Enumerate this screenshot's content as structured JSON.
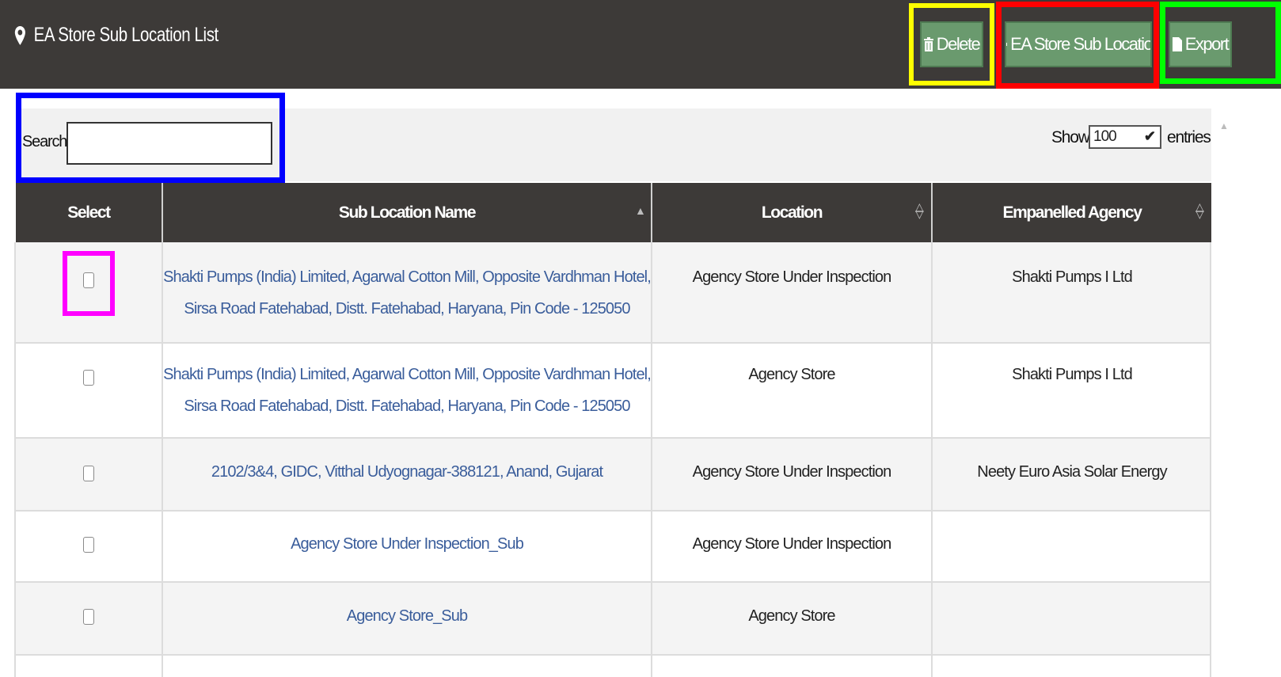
{
  "header": {
    "title": "EA Store Sub Location List",
    "buttons": {
      "delete": "Delete",
      "add": "EA Store Sub Location",
      "export": "Export"
    }
  },
  "toolbar": {
    "search_label": "Search:",
    "search_value": "",
    "show_label": "Show",
    "entries_value": "100",
    "entries_label": "entries"
  },
  "table": {
    "columns": [
      "Select",
      "Sub Location Name",
      "Location",
      "Empanelled Agency"
    ],
    "rows": [
      {
        "name_line1": "Shakti Pumps (India) Limited, Agarwal Cotton Mill, Opposite Vardhman Hotel,",
        "name_line2": "Sirsa Road Fatehabad, Distt. Fatehabad, Haryana, Pin Code - 125050",
        "location": "Agency Store Under Inspection",
        "agency": "Shakti Pumps I Ltd"
      },
      {
        "name_line1": "Shakti Pumps (India) Limited, Agarwal Cotton Mill, Opposite Vardhman Hotel,",
        "name_line2": "Sirsa Road Fatehabad, Distt. Fatehabad, Haryana, Pin Code - 125050",
        "location": "Agency Store",
        "agency": "Shakti Pumps I Ltd"
      },
      {
        "name_line1": "2102/3&4, GIDC, Vitthal Udyognagar-388121, Anand, Gujarat",
        "name_line2": "",
        "location": "Agency Store Under Inspection",
        "agency": "Neety Euro Asia Solar Energy"
      },
      {
        "name_line1": "Agency Store Under Inspection_Sub",
        "name_line2": "",
        "location": "Agency Store Under Inspection",
        "agency": ""
      },
      {
        "name_line1": "Agency Store_Sub",
        "name_line2": "",
        "location": "Agency Store",
        "agency": ""
      }
    ]
  },
  "highlight_colors": {
    "delete": "#ffff00",
    "add": "#ff0000",
    "export": "#00ff00",
    "search": "#0000ff",
    "checkbox": "#ff00ff"
  }
}
